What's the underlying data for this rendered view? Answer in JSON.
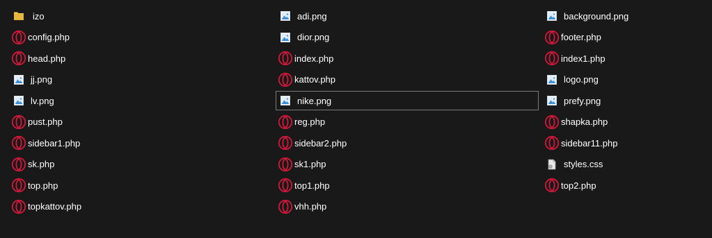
{
  "columns": [
    {
      "files": [
        {
          "name": "izo",
          "type": "folder"
        },
        {
          "name": "config.php",
          "type": "php"
        },
        {
          "name": "head.php",
          "type": "php"
        },
        {
          "name": "jj.png",
          "type": "png"
        },
        {
          "name": "lv.png",
          "type": "png"
        },
        {
          "name": "pust.php",
          "type": "php"
        },
        {
          "name": "sidebar1.php",
          "type": "php"
        },
        {
          "name": "sk.php",
          "type": "php"
        },
        {
          "name": "top.php",
          "type": "php"
        },
        {
          "name": "topkattov.php",
          "type": "php"
        }
      ]
    },
    {
      "files": [
        {
          "name": "adi.png",
          "type": "png"
        },
        {
          "name": "dior.png",
          "type": "png"
        },
        {
          "name": "index.php",
          "type": "php"
        },
        {
          "name": "kattov.php",
          "type": "php"
        },
        {
          "name": "nike.png",
          "type": "png",
          "focused": true
        },
        {
          "name": "reg.php",
          "type": "php"
        },
        {
          "name": "sidebar2.php",
          "type": "php"
        },
        {
          "name": "sk1.php",
          "type": "php"
        },
        {
          "name": "top1.php",
          "type": "php"
        },
        {
          "name": "vhh.php",
          "type": "php"
        }
      ]
    },
    {
      "files": [
        {
          "name": "background.png",
          "type": "png"
        },
        {
          "name": "footer.php",
          "type": "php"
        },
        {
          "name": "index1.php",
          "type": "php"
        },
        {
          "name": "logo.png",
          "type": "png"
        },
        {
          "name": "prefy.png",
          "type": "png"
        },
        {
          "name": "shapka.php",
          "type": "php"
        },
        {
          "name": "sidebar11.php",
          "type": "php"
        },
        {
          "name": "styles.css",
          "type": "css"
        },
        {
          "name": "top2.php",
          "type": "php"
        }
      ]
    }
  ],
  "icons": {
    "folder": "folder-icon",
    "php": "opera-file-icon",
    "png": "image-file-icon",
    "css": "css-file-icon"
  },
  "colors": {
    "background": "#191919",
    "text": "#ffffff",
    "opera_red": "#d4183c",
    "folder_yellow": "#f0c54a",
    "image_blue": "#3b8fd9",
    "focus_outline": "#7a7a7a"
  }
}
